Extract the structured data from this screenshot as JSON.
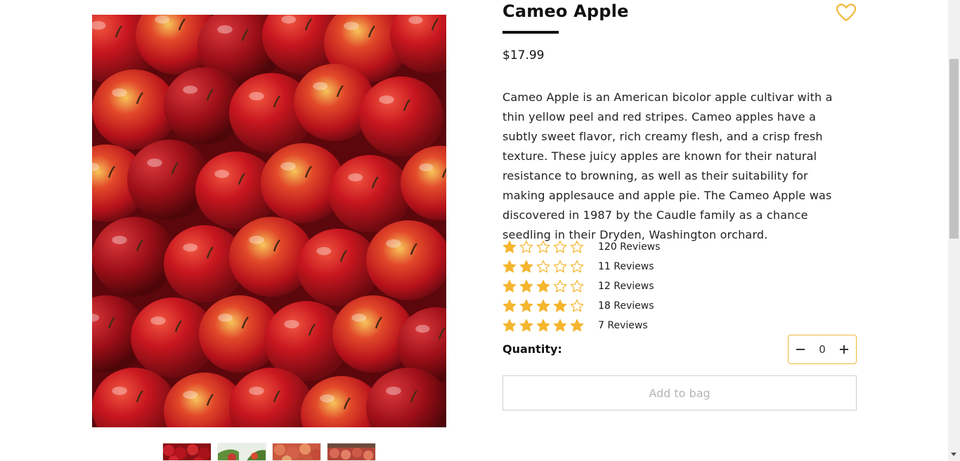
{
  "product": {
    "title": "Cameo Apple",
    "price": "$17.99",
    "description": "Cameo Apple is an American bicolor apple cultivar with a thin yellow peel and red stripes. Cameo apples have a subtly sweet flavor, rich creamy flesh, and a crisp fresh texture. These juicy apples are known for their natural resistance to browning, as well as their suitability for making applesauce and apple pie. The Cameo Apple was discovered in 1987 by the Caudle family as a chance seedling in their Dryden, Washington orchard.",
    "favorite_icon": "heart-outline-icon"
  },
  "ratings": [
    {
      "stars": 1,
      "count": "120",
      "label": "Reviews"
    },
    {
      "stars": 2,
      "count": "11",
      "label": "Reviews"
    },
    {
      "stars": 3,
      "count": "12",
      "label": "Reviews"
    },
    {
      "stars": 4,
      "count": "18",
      "label": "Reviews"
    },
    {
      "stars": 5,
      "count": "7",
      "label": "Reviews"
    }
  ],
  "quantity": {
    "label": "Quantity:",
    "value": "0",
    "decrement_icon": "minus-icon",
    "increment_icon": "plus-icon"
  },
  "actions": {
    "add_to_bag": "Add to bag"
  },
  "gallery": {
    "thumbnail_count": 4
  },
  "colors": {
    "accent": "#f0b73a",
    "star_fill": "#f5b52e",
    "text": "#111111"
  }
}
